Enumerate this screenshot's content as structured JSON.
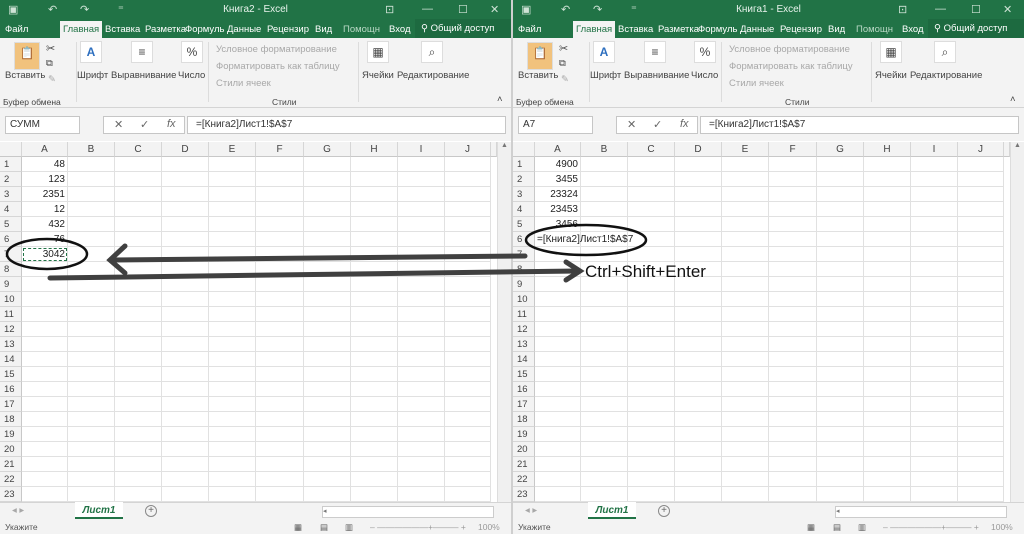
{
  "windows": [
    {
      "title": "Книга2 - Excel",
      "tabs": [
        "Файл",
        "Главная",
        "Вставка",
        "Разметка",
        "Формуль",
        "Данные",
        "Рецензир",
        "Вид"
      ],
      "active_tab": 1,
      "help": "Помощн",
      "login": "Вход",
      "share": "Общий доступ",
      "ribbon": {
        "paste": "Вставить",
        "clipboard": "Буфер обмена",
        "font": "Шрифт",
        "align": "Выравнивание",
        "number": "Число",
        "cond_format": "Условное форматирование",
        "format_table": "Форматировать как таблицу",
        "cell_styles": "Стили ячеек",
        "styles": "Стили",
        "cells": "Ячейки",
        "editing": "Редактирование"
      },
      "name_box": "СУММ",
      "formula": "=[Книга2]Лист1!$A$7",
      "columns": [
        "A",
        "B",
        "C",
        "D",
        "E",
        "F",
        "G",
        "H",
        "I",
        "J"
      ],
      "rows": 23,
      "cells_a": [
        "48",
        "123",
        "2351",
        "12",
        "432",
        "76",
        "3042"
      ],
      "sheet": "Лист1",
      "status": "Укажите",
      "zoom": "100%"
    },
    {
      "title": "Книга1 - Excel",
      "tabs": [
        "Файл",
        "Главная",
        "Вставка",
        "Разметка",
        "Формуль",
        "Данные",
        "Рецензир",
        "Вид"
      ],
      "active_tab": 1,
      "help": "Помощн",
      "login": "Вход",
      "share": "Общий доступ",
      "ribbon": {
        "paste": "Вставить",
        "clipboard": "Буфер обмена",
        "font": "Шрифт",
        "align": "Выравнивание",
        "number": "Число",
        "cond_format": "Условное форматирование",
        "format_table": "Форматировать как таблицу",
        "cell_styles": "Стили ячеек",
        "styles": "Стили",
        "cells": "Ячейки",
        "editing": "Редактирование"
      },
      "name_box": "A7",
      "formula": "=[Книга2]Лист1!$A$7",
      "columns": [
        "A",
        "B",
        "C",
        "D",
        "E",
        "F",
        "G",
        "H",
        "I",
        "J"
      ],
      "rows": 23,
      "cells_a": [
        "4900",
        "3455",
        "23324",
        "23453",
        "3456",
        "=[Книга2]Лист1!$A$7"
      ],
      "sheet": "Лист1",
      "status": "Укажите",
      "zoom": "100%"
    }
  ],
  "annotation": "Ctrl+Shift+Enter",
  "colors": {
    "excel_green": "#217346",
    "arrow": "#404040"
  }
}
